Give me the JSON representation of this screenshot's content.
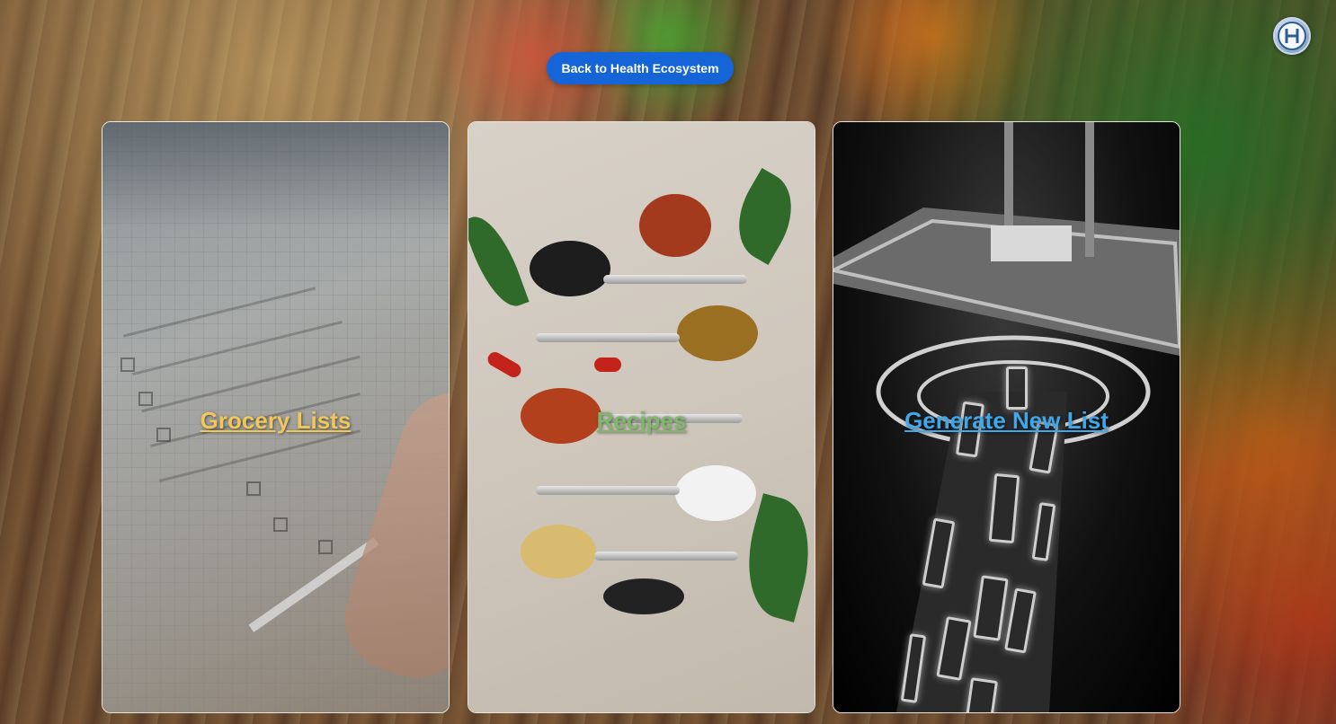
{
  "header": {
    "back_button_label": "Back to Health Ecosystem",
    "logo_icon": "health-ecosystem-logo-icon"
  },
  "cards": [
    {
      "label": "Grocery Lists",
      "label_color": "#f2c75a",
      "image": "notebook-checklist-photo"
    },
    {
      "label": "Recipes",
      "label_color": "#7fb86a",
      "image": "spices-on-spoons-photo"
    },
    {
      "label": "Generate New List",
      "label_color": "#3ea8ea",
      "image": "abstract-glowing-machine-photo"
    }
  ],
  "colors": {
    "button_blue": "#1565d8",
    "card_border": "#ffffff"
  }
}
